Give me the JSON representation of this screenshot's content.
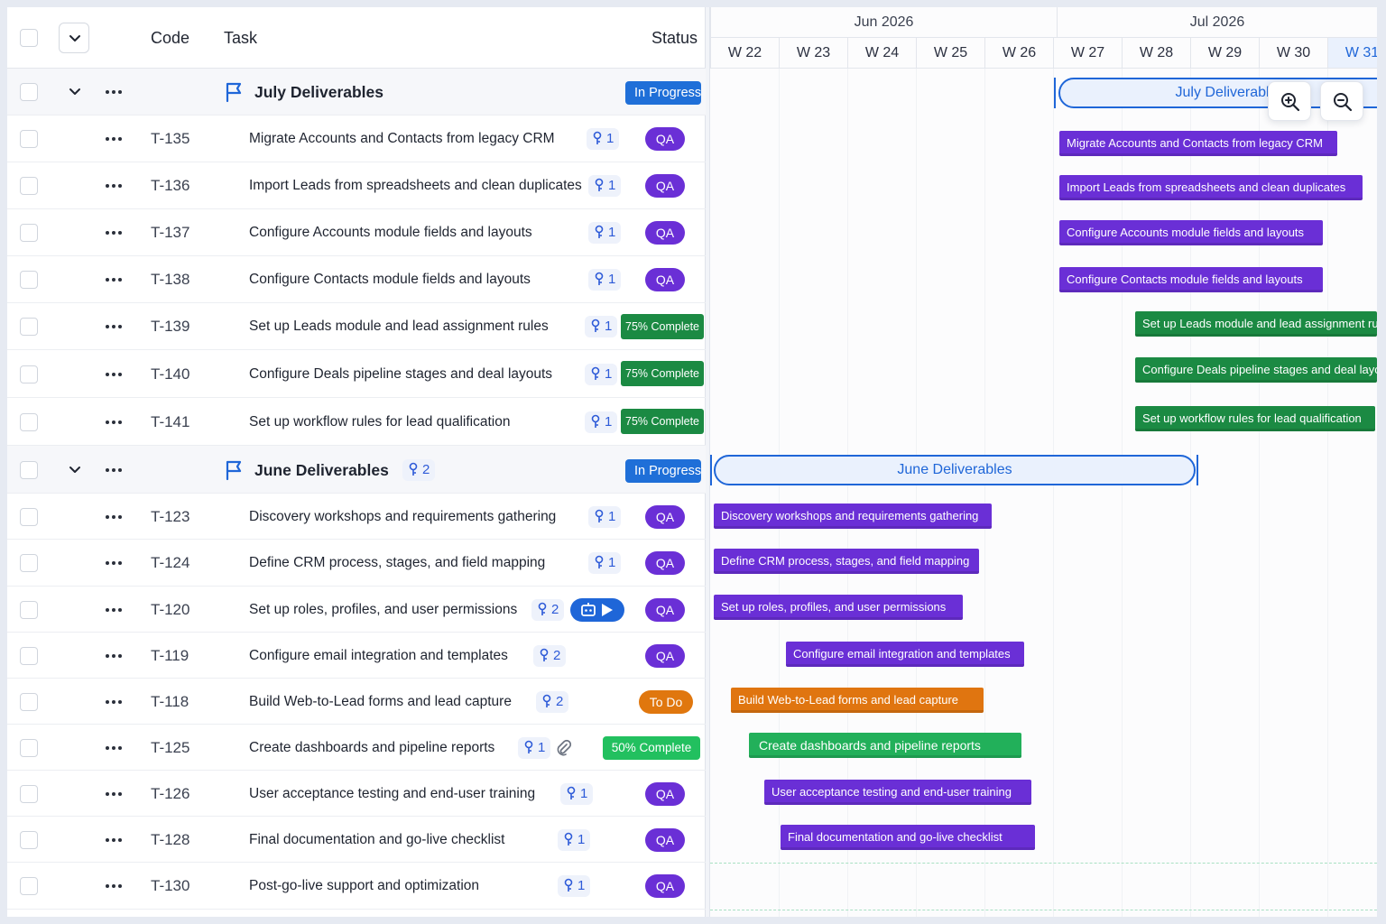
{
  "header": {
    "code_label": "Code",
    "task_label": "Task",
    "status_label": "Status"
  },
  "timeline": {
    "months": [
      "Jun 2026",
      "Jul 2026"
    ],
    "weeks": [
      "W 22",
      "W 23",
      "W 24",
      "W 25",
      "W 26",
      "W 27",
      "W 28",
      "W 29",
      "W 30",
      "W 31"
    ],
    "current_week": "W 31"
  },
  "groups": {
    "july": {
      "title": "July Deliverables",
      "status": "In Progress",
      "bar_label": "July Deliverables"
    },
    "june": {
      "title": "June Deliverables",
      "subtasks": "2",
      "status": "In Progress",
      "bar_label": "June Deliverables"
    }
  },
  "tasks": [
    {
      "code": "T-135",
      "name": "Migrate Accounts and Contacts from legacy CRM",
      "subtasks": "1",
      "status": "QA",
      "bar": "Migrate Accounts and Contacts from legacy CRM"
    },
    {
      "code": "T-136",
      "name": "Import Leads from spreadsheets and clean duplicates",
      "subtasks": "1",
      "status": "QA",
      "bar": "Import Leads from spreadsheets and clean duplicates"
    },
    {
      "code": "T-137",
      "name": "Configure Accounts module fields and layouts",
      "subtasks": "1",
      "status": "QA",
      "bar": "Configure Accounts module fields and layouts"
    },
    {
      "code": "T-138",
      "name": "Configure Contacts module fields and layouts",
      "subtasks": "1",
      "status": "QA",
      "bar": "Configure Contacts module fields and layouts"
    },
    {
      "code": "T-139",
      "name": "Set up Leads module and lead assignment rules",
      "subtasks": "1",
      "status": "75% Complete",
      "bar": "Set up Leads module and lead assignment rules"
    },
    {
      "code": "T-140",
      "name": "Configure Deals pipeline stages and deal layouts",
      "subtasks": "1",
      "status": "75% Complete",
      "bar": "Configure Deals pipeline stages and deal layouts"
    },
    {
      "code": "T-141",
      "name": "Set up workflow rules for lead qualification",
      "subtasks": "1",
      "status": "75% Complete",
      "bar": "Set up workflow rules for lead qualification"
    },
    {
      "code": "T-123",
      "name": "Discovery workshops and requirements gathering",
      "subtasks": "1",
      "status": "QA",
      "bar": "Discovery workshops and requirements gathering"
    },
    {
      "code": "T-124",
      "name": "Define CRM process, stages, and field mapping",
      "subtasks": "1",
      "status": "QA",
      "bar": "Define CRM process, stages, and field mapping"
    },
    {
      "code": "T-120",
      "name": "Set up roles, profiles, and user permissions",
      "subtasks": "2",
      "status": "QA",
      "bar": "Set up roles, profiles, and user permissions"
    },
    {
      "code": "T-119",
      "name": "Configure email integration and templates",
      "subtasks": "2",
      "status": "QA",
      "bar": "Configure email integration and templates"
    },
    {
      "code": "T-118",
      "name": "Build Web-to-Lead forms and lead capture",
      "subtasks": "2",
      "status": "To Do",
      "bar": "Build Web-to-Lead forms and lead capture"
    },
    {
      "code": "T-125",
      "name": "Create dashboards and pipeline reports",
      "subtasks": "1",
      "status": "50% Complete",
      "bar": "Create dashboards and pipeline reports"
    },
    {
      "code": "T-126",
      "name": "User acceptance testing and end-user training",
      "subtasks": "1",
      "status": "QA",
      "bar": "User acceptance testing and end-user training"
    },
    {
      "code": "T-128",
      "name": "Final documentation and go-live checklist",
      "subtasks": "1",
      "status": "QA",
      "bar": "Final documentation and go-live checklist"
    },
    {
      "code": "T-130",
      "name": "Post-go-live support and optimization",
      "subtasks": "1",
      "status": "QA",
      "bar": ""
    }
  ],
  "colors": {
    "qa": "#6a2fd6",
    "in_progress": "#1f6fd8",
    "complete_75": "#1b8a43",
    "complete_50": "#22c05f",
    "todo": "#e0770e"
  },
  "icons": [
    "chevron-down-icon",
    "more-dots-icon",
    "flag-icon",
    "subtask-icon",
    "robot-play-icon",
    "paperclip-icon",
    "zoom-in-icon",
    "zoom-out-icon"
  ]
}
